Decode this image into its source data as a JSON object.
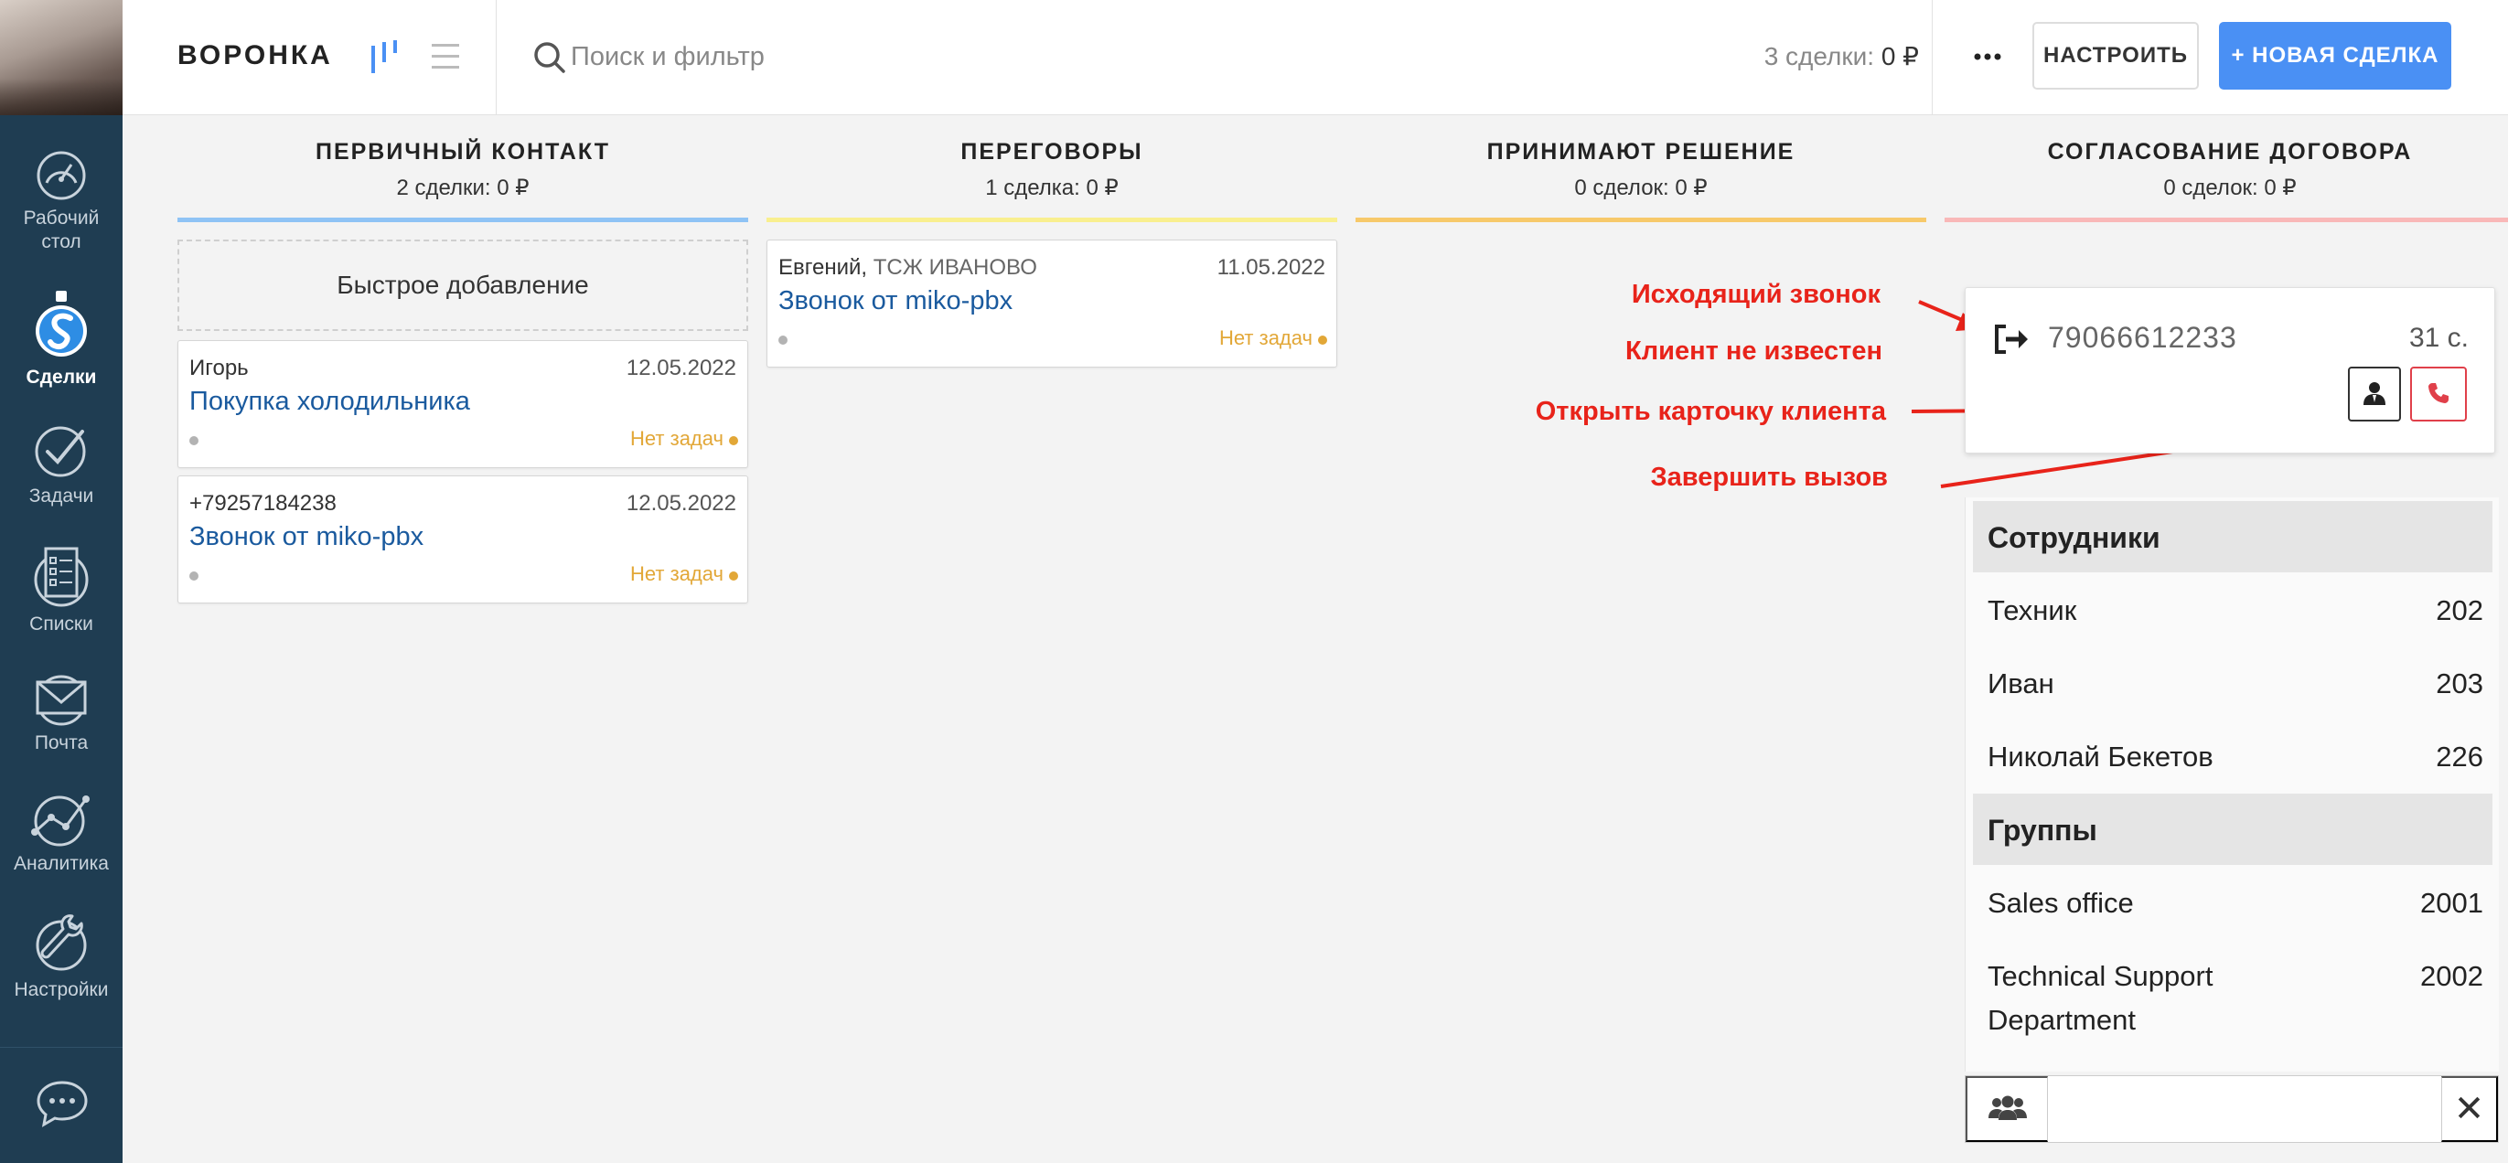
{
  "sidebar": {
    "items": [
      {
        "label": "Рабочий стол",
        "icon": "dashboard-gauge-icon"
      },
      {
        "label": "Сделки",
        "icon": "deals-logo-icon",
        "active": true
      },
      {
        "label": "Задачи",
        "icon": "tasks-check-icon"
      },
      {
        "label": "Списки",
        "icon": "lists-icon"
      },
      {
        "label": "Почта",
        "icon": "mail-icon"
      },
      {
        "label": "Аналитика",
        "icon": "analytics-icon"
      },
      {
        "label": "Настройки",
        "icon": "settings-wrench-icon"
      }
    ],
    "chat_icon": "chat-bubble-icon"
  },
  "header": {
    "title": "ВОРОНКА",
    "search_placeholder": "Поиск и фильтр",
    "count_label": "3 сделки:",
    "count_value": "0 ₽",
    "setup_button": "НАСТРОИТЬ",
    "new_deal_button": "+ НОВАЯ СДЕЛКА"
  },
  "columns": [
    {
      "title": "ПЕРВИЧНЫЙ КОНТАКТ",
      "count": "2 сделки: 0 ₽",
      "color": "#8fc3f5"
    },
    {
      "title": "ПЕРЕГОВОРЫ",
      "count": "1 сделка: 0 ₽",
      "color": "#f9ef8f"
    },
    {
      "title": "ПРИНИМАЮТ РЕШЕНИЕ",
      "count": "0 сделок: 0 ₽",
      "color": "#f7c96a"
    },
    {
      "title": "СОГЛАСОВАНИЕ ДОГОВОРА",
      "count": "0 сделок: 0 ₽",
      "color": "#f9b8b8"
    }
  ],
  "quick_add": "Быстрое добавление",
  "cards": [
    {
      "contact": "Игорь",
      "company": "",
      "date": "12.05.2022",
      "title": "Покупка холодильника",
      "tasks": "Нет задач"
    },
    {
      "contact": "+79257184238",
      "company": "",
      "date": "12.05.2022",
      "title": "Звонок от miko-pbx",
      "tasks": "Нет задач"
    },
    {
      "contact": "Евгений,",
      "company": "ТСЖ ИВАНОВО",
      "date": "11.05.2022",
      "title": "Звонок от miko-pbx",
      "tasks": "Нет задач"
    }
  ],
  "annotations": {
    "outgoing": "Исходящий звонок",
    "unknown": "Клиент не известен",
    "open_card": "Открыть карточку клиента",
    "end_call": "Завершить вызов"
  },
  "call": {
    "direction_icon": "outgoing-call-icon",
    "number": "79066612233",
    "duration": "31 с.",
    "open_card_icon": "client-card-icon",
    "end_call_icon": "hangup-phone-icon"
  },
  "directory": {
    "employees_title": "Сотрудники",
    "employees": [
      {
        "name": "Техник",
        "ext": "202"
      },
      {
        "name": "Иван",
        "ext": "203"
      },
      {
        "name": "Николай Бекетов",
        "ext": "226"
      }
    ],
    "groups_title": "Группы",
    "groups": [
      {
        "name": "Sales office",
        "ext": "2001"
      },
      {
        "name_line1": "Technical Support",
        "name_line2": "Department",
        "ext": "2002"
      }
    ],
    "search_value": "",
    "group_icon": "group-users-icon",
    "close_icon": "close-icon",
    "close_glyph": "✕"
  }
}
